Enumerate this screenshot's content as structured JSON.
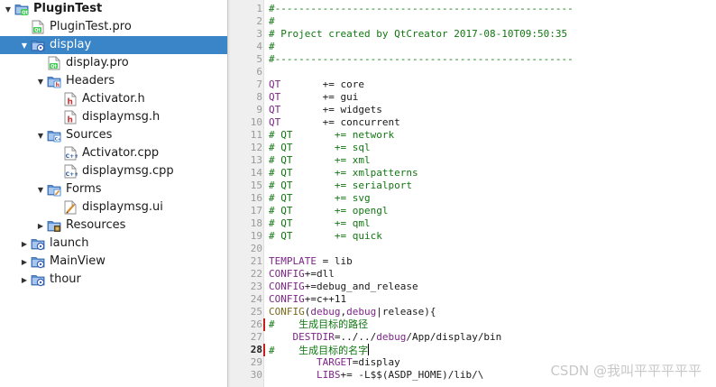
{
  "tree": {
    "items": [
      {
        "label": "PluginTest",
        "icon": "qt-project-root-icon",
        "depth": 0,
        "arrow": "expanded",
        "bold": true
      },
      {
        "label": "PluginTest.pro",
        "icon": "pro-file-icon",
        "depth": 1,
        "arrow": "none"
      },
      {
        "label": "display",
        "icon": "subproject-folder-icon",
        "depth": 1,
        "arrow": "expanded",
        "selected": true
      },
      {
        "label": "display.pro",
        "icon": "pro-file-icon",
        "depth": 2,
        "arrow": "none"
      },
      {
        "label": "Headers",
        "icon": "headers-folder-icon",
        "depth": 2,
        "arrow": "expanded"
      },
      {
        "label": "Activator.h",
        "icon": "header-file-icon",
        "depth": 3,
        "arrow": "none"
      },
      {
        "label": "displaymsg.h",
        "icon": "header-file-icon",
        "depth": 3,
        "arrow": "none"
      },
      {
        "label": "Sources",
        "icon": "sources-folder-icon",
        "depth": 2,
        "arrow": "expanded"
      },
      {
        "label": "Activator.cpp",
        "icon": "cpp-file-icon",
        "depth": 3,
        "arrow": "none"
      },
      {
        "label": "displaymsg.cpp",
        "icon": "cpp-file-icon",
        "depth": 3,
        "arrow": "none"
      },
      {
        "label": "Forms",
        "icon": "forms-folder-icon",
        "depth": 2,
        "arrow": "expanded"
      },
      {
        "label": "displaymsg.ui",
        "icon": "ui-file-icon",
        "depth": 3,
        "arrow": "none"
      },
      {
        "label": "Resources",
        "icon": "resources-folder-icon",
        "depth": 2,
        "arrow": "collapsed"
      },
      {
        "label": "launch",
        "icon": "subproject-folder-icon",
        "depth": 1,
        "arrow": "collapsed"
      },
      {
        "label": "MainView",
        "icon": "subproject-folder-icon",
        "depth": 1,
        "arrow": "collapsed"
      },
      {
        "label": "thour",
        "icon": "subproject-folder-icon",
        "depth": 1,
        "arrow": "collapsed"
      }
    ]
  },
  "editor": {
    "current_line": 28,
    "changed_lines": [
      26,
      28
    ],
    "lines": [
      {
        "n": "1",
        "segs": [
          [
            "#--------------------------------------------------",
            "green"
          ]
        ]
      },
      {
        "n": "2",
        "segs": [
          [
            "#",
            "green"
          ]
        ]
      },
      {
        "n": "3",
        "segs": [
          [
            "# Project created by QtCreator 2017-08-10T09:50:35",
            "green"
          ]
        ]
      },
      {
        "n": "4",
        "segs": [
          [
            "#",
            "green"
          ]
        ]
      },
      {
        "n": "5",
        "segs": [
          [
            "#--------------------------------------------------",
            "green"
          ]
        ]
      },
      {
        "n": "6",
        "segs": []
      },
      {
        "n": "7",
        "segs": [
          [
            "QT",
            "purple"
          ],
          [
            "       += core",
            "black"
          ]
        ]
      },
      {
        "n": "8",
        "segs": [
          [
            "QT",
            "purple"
          ],
          [
            "       += gui",
            "black"
          ]
        ]
      },
      {
        "n": "9",
        "segs": [
          [
            "QT",
            "purple"
          ],
          [
            "       += widgets",
            "black"
          ]
        ]
      },
      {
        "n": "10",
        "segs": [
          [
            "QT",
            "purple"
          ],
          [
            "       += concurrent",
            "black"
          ]
        ]
      },
      {
        "n": "11",
        "segs": [
          [
            "# QT       += network",
            "green"
          ]
        ]
      },
      {
        "n": "12",
        "segs": [
          [
            "# QT       += sql",
            "green"
          ]
        ]
      },
      {
        "n": "13",
        "segs": [
          [
            "# QT       += xml",
            "green"
          ]
        ]
      },
      {
        "n": "14",
        "segs": [
          [
            "# QT       += xmlpatterns",
            "green"
          ]
        ]
      },
      {
        "n": "15",
        "segs": [
          [
            "# QT       += serialport",
            "green"
          ]
        ]
      },
      {
        "n": "16",
        "segs": [
          [
            "# QT       += svg",
            "green"
          ]
        ]
      },
      {
        "n": "17",
        "segs": [
          [
            "# QT       += opengl",
            "green"
          ]
        ]
      },
      {
        "n": "18",
        "segs": [
          [
            "# QT       += qml",
            "green"
          ]
        ]
      },
      {
        "n": "19",
        "segs": [
          [
            "# QT       += quick",
            "green"
          ]
        ]
      },
      {
        "n": "20",
        "segs": []
      },
      {
        "n": "21",
        "segs": [
          [
            "TEMPLATE",
            "purple"
          ],
          [
            " = lib",
            "black"
          ]
        ]
      },
      {
        "n": "22",
        "segs": [
          [
            "CONFIG",
            "purple"
          ],
          [
            "+=dll",
            "black"
          ]
        ]
      },
      {
        "n": "23",
        "segs": [
          [
            "CONFIG",
            "purple"
          ],
          [
            "+=debug_and_release",
            "black"
          ]
        ]
      },
      {
        "n": "24",
        "segs": [
          [
            "CONFIG",
            "purple"
          ],
          [
            "+=c++11",
            "black"
          ]
        ]
      },
      {
        "n": "25",
        "segs": [
          [
            "CONFIG",
            "olive"
          ],
          [
            "(",
            "black"
          ],
          [
            "debug",
            "purple"
          ],
          [
            ",",
            "black"
          ],
          [
            "debug",
            "purple"
          ],
          [
            "|release){",
            "black"
          ]
        ]
      },
      {
        "n": "26",
        "segs": [
          [
            "#    ",
            "green"
          ],
          [
            "生成目标的路径",
            "cn"
          ]
        ]
      },
      {
        "n": "27",
        "segs": [
          [
            "    ",
            "black"
          ],
          [
            "DESTDIR",
            "purple"
          ],
          [
            "=../../",
            "black"
          ],
          [
            "debug",
            "purple"
          ],
          [
            "/App/display/bin",
            "black"
          ]
        ]
      },
      {
        "n": "28",
        "segs": [
          [
            "#    ",
            "green"
          ],
          [
            "生成目标的名字",
            "cn"
          ]
        ],
        "cursor": true
      },
      {
        "n": "29",
        "segs": [
          [
            "        ",
            "black"
          ],
          [
            "TARGET",
            "purple"
          ],
          [
            "=display",
            "black"
          ]
        ]
      },
      {
        "n": "30",
        "segs": [
          [
            "        ",
            "black"
          ],
          [
            "LIBS",
            "purple"
          ],
          [
            "+= -L$$(ASDP_HOME)/lib/\\",
            "black"
          ]
        ]
      }
    ]
  },
  "watermark": "CSDN @我叫平平平平平",
  "colors": {
    "selection": "#3a84c8",
    "comment": "#117711",
    "keyword": "#7d2488",
    "function": "#7a6a1a",
    "change_marker": "#c81e1e"
  }
}
